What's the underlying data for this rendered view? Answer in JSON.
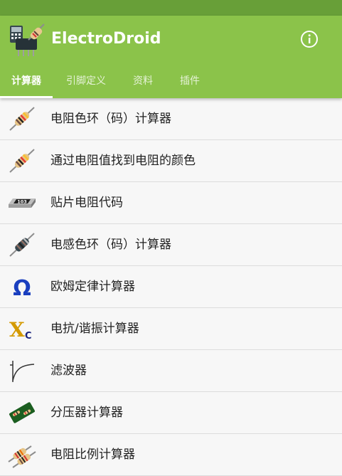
{
  "app": {
    "title": "ElectroDroid"
  },
  "colors": {
    "status_bar": "#689f38",
    "app_bar": "#8bc34a",
    "text": "#222222",
    "background": "#f7f7f7"
  },
  "tabs": [
    {
      "label": "计算器",
      "active": true
    },
    {
      "label": "引脚定义",
      "active": false
    },
    {
      "label": "资料",
      "active": false
    },
    {
      "label": "插件",
      "active": false
    }
  ],
  "calculators": [
    {
      "label": "电阻色环（码）计算器",
      "icon": "resistor-color-code-icon"
    },
    {
      "label": "通过电阻值找到电阻的颜色",
      "icon": "resistor-value-to-color-icon"
    },
    {
      "label": "贴片电阻代码",
      "icon": "smd-resistor-icon",
      "icon_text": "103"
    },
    {
      "label": "电感色环（码）计算器",
      "icon": "inductor-icon"
    },
    {
      "label": "欧姆定律计算器",
      "icon": "ohm-symbol-icon",
      "icon_text": "Ω"
    },
    {
      "label": "电抗/谐振计算器",
      "icon": "reactance-icon",
      "icon_text": "X",
      "icon_sub": "C"
    },
    {
      "label": "滤波器",
      "icon": "filter-curve-icon"
    },
    {
      "label": "分压器计算器",
      "icon": "voltage-divider-icon"
    },
    {
      "label": "电阻比例计算器",
      "icon": "resistor-ratio-icon"
    }
  ]
}
